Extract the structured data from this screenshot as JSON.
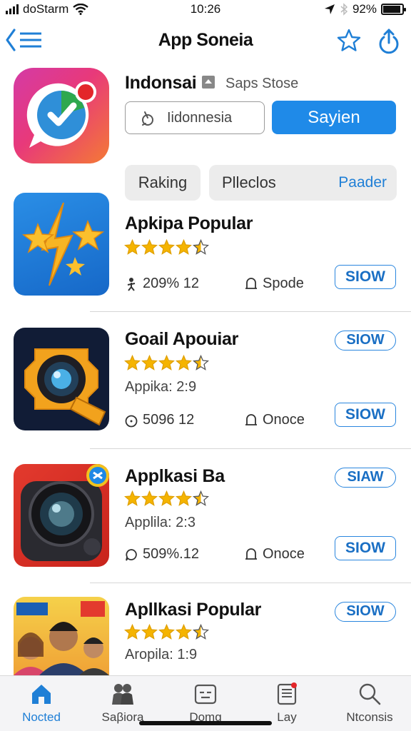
{
  "status_bar": {
    "carrier": "doStarm",
    "time": "10:26",
    "battery": "92%"
  },
  "nav": {
    "title": "App Soneia",
    "back_icon": "chevron-left-list-icon",
    "right_icons": [
      "star-icon",
      "share-icon"
    ]
  },
  "header": {
    "title": "Indonsai",
    "subtitle": "Saps Stose",
    "search_value": "Iidonnesia",
    "primary_button": "Sayien",
    "segment_left": "Raking",
    "segment_right": "Plleclos",
    "segment_link": "Paader"
  },
  "apps": [
    {
      "name": "Apkipa Popular",
      "rating": 4.5,
      "subtitle": "",
      "meta_left": "209% 12",
      "meta_right": "Spode",
      "button_top": "",
      "button_bottom": "SIOW"
    },
    {
      "name": "Goail Apouiar",
      "rating": 4.5,
      "subtitle": "Appika: 2:9",
      "meta_left": "5096 12",
      "meta_right": "Onoce",
      "button_top": "SIOW",
      "button_bottom": "SIOW"
    },
    {
      "name": "Applkasi Ba",
      "rating": 4.5,
      "subtitle": "Applila: 2:3",
      "meta_left": "509%.12",
      "meta_right": "Onoce",
      "button_top": "SIAW",
      "button_bottom": "SIOW"
    },
    {
      "name": "Apllkasi Popular",
      "rating": 4.5,
      "subtitle": "Aropila: 1:9",
      "meta_left": "",
      "meta_right": "",
      "button_top": "SIOW",
      "button_bottom": ""
    }
  ],
  "tabs": [
    {
      "label": "Nocted",
      "icon": "home-icon",
      "active": true
    },
    {
      "label": "Saβiora",
      "icon": "people-icon",
      "active": false
    },
    {
      "label": "Domg",
      "icon": "wallet-icon",
      "active": false
    },
    {
      "label": "Lay",
      "icon": "clipboard-icon",
      "active": false
    },
    {
      "label": "Ntconsis",
      "icon": "search-icon",
      "active": false
    }
  ],
  "colors": {
    "accent": "#1f8ae8",
    "star": "#f5b400",
    "link": "#1f7fd6"
  }
}
